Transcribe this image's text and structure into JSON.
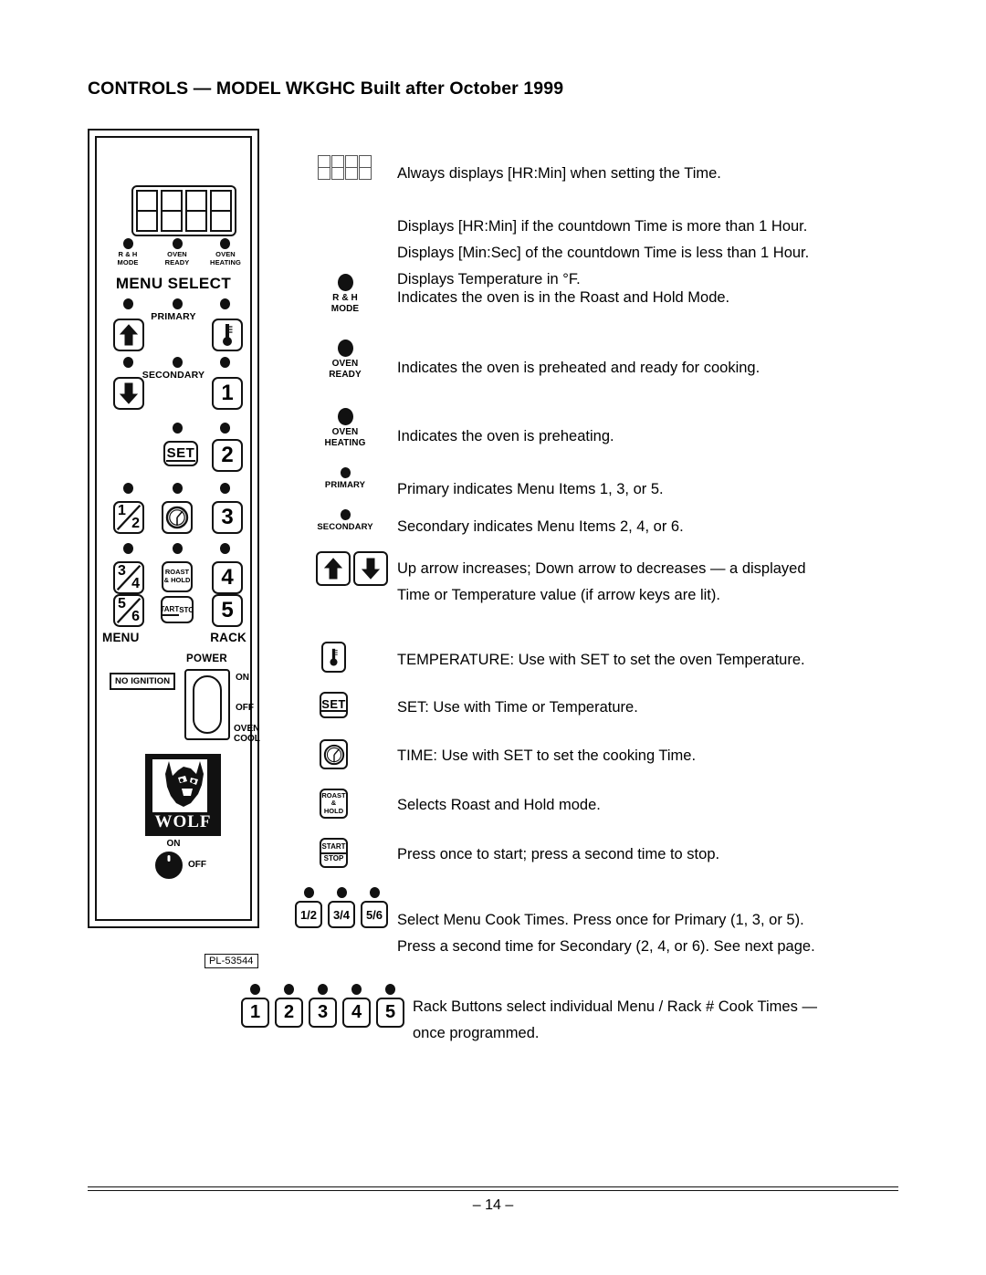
{
  "title": "CONTROLS — MODEL WKGHC Built after October 1999",
  "panel": {
    "display_digits": 4,
    "indicators_top": [
      {
        "name": "r-h-mode",
        "label": "R & H\nMODE"
      },
      {
        "name": "oven-ready",
        "label": "OVEN\nREADY"
      },
      {
        "name": "oven-heating",
        "label": "OVEN\nHEATING"
      }
    ],
    "menu_select_label": "MENU SELECT",
    "primary_label": "PRIMARY",
    "secondary_label": "SECONDARY",
    "keys": {
      "up_arrow": "up-arrow",
      "down_arrow": "down-arrow",
      "temperature": "thermometer",
      "set": "SET",
      "time": "clock",
      "roast_hold": "ROAST\n&\nHOLD",
      "start": "START",
      "stop": "STOP",
      "menu_12_top": "1",
      "menu_12_bottom": "2",
      "menu_34_top": "3",
      "menu_34_bottom": "4",
      "menu_56_top": "5",
      "menu_56_bottom": "6",
      "rack_numbers": [
        "1",
        "2",
        "3",
        "4",
        "5"
      ]
    },
    "menu_word": "MENU",
    "rack_word": "RACK",
    "no_ignition": "NO IGNITION",
    "power_word": "POWER",
    "power_positions": [
      "ON",
      "OFF",
      "OVEN\nCOOL"
    ],
    "logo_text": "WOLF",
    "knob_on": "ON",
    "knob_off": "OFF",
    "part_number": "PL-53544"
  },
  "legend": {
    "display": {
      "icon": "seven-segment-display",
      "text": "Always displays [HR:Min] when setting the Time.\n\nDisplays [HR:Min] if the countdown Time is more than 1 Hour.\nDisplays [Min:Sec] of the countdown Time is less than 1 Hour.\nDisplays Temperature in °F."
    },
    "rh_mode": {
      "caption": "R & H\nMODE",
      "text": "Indicates the oven is in the Roast and Hold Mode."
    },
    "oven_ready": {
      "caption": "OVEN\nREADY",
      "text": "Indicates the oven is preheated and ready for cooking."
    },
    "oven_heating": {
      "caption": "OVEN\nHEATING",
      "text": "Indicates the oven is preheating."
    },
    "primary": {
      "caption": "PRIMARY",
      "text": "Primary indicates Menu Items 1, 3, or 5."
    },
    "secondary": {
      "caption": "SECONDARY",
      "text": "Secondary indicates Menu Items 2, 4, or 6."
    },
    "arrows": {
      "text": "Up arrow increases; Down arrow to decreases — a displayed\nTime or Temperature value (if arrow keys are lit)."
    },
    "temperature": {
      "text": "TEMPERATURE: Use with SET to set the oven Temperature."
    },
    "set": {
      "label": "SET",
      "text": "SET:  Use with Time or Temperature."
    },
    "time": {
      "text": "TIME: Use with SET to set the cooking Time."
    },
    "roast_hold": {
      "label": "ROAST\n&\nHOLD",
      "text": "Selects Roast and Hold mode."
    },
    "start_stop": {
      "top": "START",
      "bottom": "STOP",
      "text": "Press once to start; press a second time to stop."
    },
    "menu_times": {
      "buttons": [
        "1/2",
        "3/4",
        "5/6"
      ],
      "text": "Select Menu Cook Times. Press once for Primary (1, 3, or 5).\nPress a second time for Secondary (2, 4, or 6). See next page."
    },
    "rack_buttons": {
      "buttons": [
        "1",
        "2",
        "3",
        "4",
        "5"
      ],
      "text": "Rack Buttons select individual Menu / Rack # Cook Times —\nonce programmed."
    }
  },
  "footer": {
    "page_number": "– 14 –"
  }
}
